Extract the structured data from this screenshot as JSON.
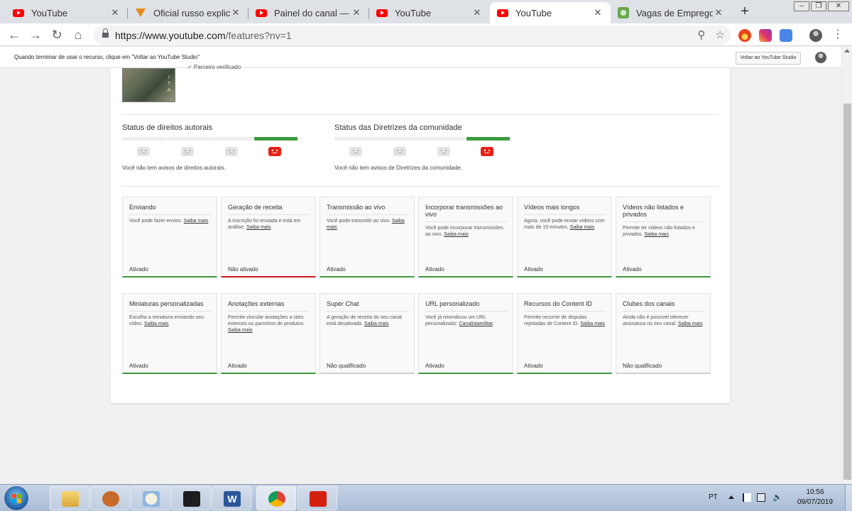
{
  "browser": {
    "tabs": [
      {
        "title": "YouTube",
        "icon": "youtube-icon"
      },
      {
        "title": "Oficial russo explica por",
        "icon": "fox-icon"
      },
      {
        "title": "Painel do canal — YouTube",
        "icon": "youtube-icon"
      },
      {
        "title": "YouTube",
        "icon": "youtube-icon"
      },
      {
        "title": "YouTube",
        "icon": "youtube-icon",
        "active": true
      },
      {
        "title": "Vagas de Emprego em",
        "icon": "vagas-icon"
      }
    ],
    "url_host": "https://www.youtube.com",
    "url_path": "/features?nv=1"
  },
  "notice": {
    "text": "Quando terminar de usar o recurso, clique em \"Voltar ao YouTube Studio\"",
    "button": "Voltar ao YouTube Studio"
  },
  "channel": {
    "verified": "✓ Parceiro verificado",
    "avatar_letters": "I\nT\nA"
  },
  "copyright": {
    "title": "Status de direitos autorais",
    "note": "Você não tem avisos de direitos autorais."
  },
  "community": {
    "title": "Status das Diretrizes da comunidade",
    "note": "Você não tem avisos de Diretrizes da comunidade."
  },
  "features": [
    {
      "title": "Enviando",
      "desc": "Você pode fazer envios.",
      "link": "Saiba mais",
      "state": "Ativado",
      "status": "ok"
    },
    {
      "title": "Geração de receita",
      "desc": "A inscrição foi enviada e está em análise.",
      "link": "Saiba mais",
      "state": "Não ativado",
      "status": "bad"
    },
    {
      "title": "Transmissão ao vivo",
      "desc": "Você pode transmitir ao vivo.",
      "link": "Saiba mais",
      "state": "Ativado",
      "status": "ok"
    },
    {
      "title": "Incorporar transmissões ao vivo",
      "desc": "Você pode incorporar transmissões ao vivo.",
      "link": "Saiba mais",
      "state": "Ativado",
      "status": "ok"
    },
    {
      "title": "Vídeos mais longos",
      "desc": "Agora, você pode enviar vídeos com mais de 15 minutos.",
      "link": "Saiba mais",
      "state": "Ativado",
      "status": "ok"
    },
    {
      "title": "Vídeos não listados e privados",
      "desc": "Permite ter vídeos não listados e privados.",
      "link": "Saiba mais",
      "state": "Ativado",
      "status": "ok"
    },
    {
      "title": "Miniaturas personalizadas",
      "desc": "Escolha a miniatura enviando seu vídeo.",
      "link": "Saiba mais",
      "state": "Ativado",
      "status": "ok"
    },
    {
      "title": "Anotações externas",
      "desc": "Permite vincular anotações a sites externos ou parceiros de produtos.",
      "link": "Saiba mais",
      "state": "Ativado",
      "status": "ok"
    },
    {
      "title": "Super Chat",
      "desc": "A geração de receita do seu canal está desativada.",
      "link": "Saiba mais",
      "state": "Não qualificado",
      "status": "neutral"
    },
    {
      "title": "URL personalizado",
      "desc": "Você já reivindicou um URL personalizado:",
      "link": "Canalistamilitar",
      "state": "Ativado",
      "status": "ok"
    },
    {
      "title": "Recursos do Content ID",
      "desc": "Permite recorrer de disputas rejeitadas de Content ID.",
      "link": "Saiba mais",
      "state": "Ativado",
      "status": "ok"
    },
    {
      "title": "Clubes dos canais",
      "desc": "Ainda não é possível oferecer assinatura no seu canal.",
      "link": "Saiba mais",
      "state": "Não qualificado",
      "status": "neutral"
    }
  ],
  "taskbar": {
    "lang": "PT",
    "time": "10:56",
    "date": "09/07/2019"
  },
  "colors": {
    "ok": "#3c9a3c",
    "bad": "#cc181e",
    "neutral": "#cfcfcf",
    "youtube_red": "#ff0000"
  }
}
